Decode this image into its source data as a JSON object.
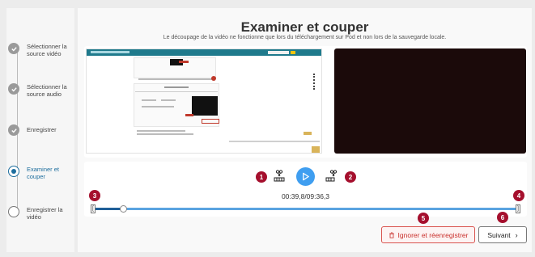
{
  "steps": [
    {
      "label": "Sélectionner la source vidéo",
      "state": "done"
    },
    {
      "label": "Sélectionner la source audio",
      "state": "done"
    },
    {
      "label": "Enregistrer",
      "state": "done"
    },
    {
      "label": "Examiner et couper",
      "state": "active"
    },
    {
      "label": "Enregistrer la vidéo",
      "state": "todo"
    }
  ],
  "header": {
    "title": "Examiner et couper",
    "subtitle": "Le découpage de la vidéo ne fonctionne que lors du téléchargement sur Pod et non lors de la sauvegarde locale."
  },
  "badges": {
    "b1": "1",
    "b2": "2",
    "b3": "3",
    "b4": "4",
    "b5": "5",
    "b6": "6"
  },
  "player": {
    "time": "00:39,8/09:36,3",
    "progress": 0.069
  },
  "timeline": {
    "start_bracket": "[",
    "end_bracket": "]"
  },
  "actions": {
    "ignore_label": "Ignorer et réenregistrer",
    "next_label": "Suivant",
    "next_chevron": "›"
  },
  "colors": {
    "accent": "#3f9ef0",
    "badge": "#a50f2d",
    "danger": "#d9534f",
    "active_step": "#1e6e9e"
  },
  "icons": {
    "done": "check-icon",
    "play": "play-icon",
    "cut_start": "cut-start-icon",
    "cut_end": "cut-end-icon",
    "trash": "trash-icon"
  }
}
